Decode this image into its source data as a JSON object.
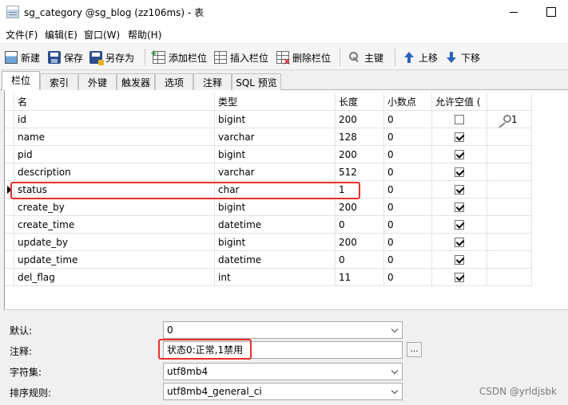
{
  "window": {
    "title": "sg_category @sg_blog (zz106ms) - 表"
  },
  "menu": [
    "文件(F)",
    "编辑(E)",
    "窗口(W)",
    "帮助(H)"
  ],
  "toolbar": {
    "new": "新建",
    "save": "保存",
    "save_as": "另存为",
    "add_column": "添加栏位",
    "insert_column": "插入栏位",
    "delete_column": "删除栏位",
    "primary_key": "主键",
    "move_up": "上移",
    "move_down": "下移"
  },
  "tabs": [
    "栏位",
    "索引",
    "外键",
    "触发器",
    "选项",
    "注释",
    "SQL 预览"
  ],
  "grid": {
    "headers": [
      "名",
      "类型",
      "长度",
      "小数点",
      "允许空值 ("
    ],
    "rows": [
      {
        "name": "id",
        "type": "bigint",
        "length": "200",
        "decimals": "0",
        "nullable": false,
        "key": "1"
      },
      {
        "name": "name",
        "type": "varchar",
        "length": "128",
        "decimals": "0",
        "nullable": true,
        "key": ""
      },
      {
        "name": "pid",
        "type": "bigint",
        "length": "200",
        "decimals": "0",
        "nullable": true,
        "key": ""
      },
      {
        "name": "description",
        "type": "varchar",
        "length": "512",
        "decimals": "0",
        "nullable": true,
        "key": ""
      },
      {
        "name": "status",
        "type": "char",
        "length": "1",
        "decimals": "0",
        "nullable": true,
        "key": ""
      },
      {
        "name": "create_by",
        "type": "bigint",
        "length": "200",
        "decimals": "0",
        "nullable": true,
        "key": ""
      },
      {
        "name": "create_time",
        "type": "datetime",
        "length": "0",
        "decimals": "0",
        "nullable": true,
        "key": ""
      },
      {
        "name": "update_by",
        "type": "bigint",
        "length": "200",
        "decimals": "0",
        "nullable": true,
        "key": ""
      },
      {
        "name": "update_time",
        "type": "datetime",
        "length": "0",
        "decimals": "0",
        "nullable": true,
        "key": ""
      },
      {
        "name": "del_flag",
        "type": "int",
        "length": "11",
        "decimals": "0",
        "nullable": true,
        "key": ""
      }
    ]
  },
  "properties": {
    "default_label": "默认:",
    "default_value": "0",
    "comment_label": "注释:",
    "comment_value": "状态0:正常,1禁用",
    "charset_label": "字符集:",
    "charset_value": "utf8mb4",
    "collation_label": "排序规则:",
    "collation_value": "utf8mb4_general_ci",
    "ellipsis": "..."
  },
  "watermark": "CSDN @yrldjsbk",
  "colors": {
    "highlight": "#e8302a"
  }
}
